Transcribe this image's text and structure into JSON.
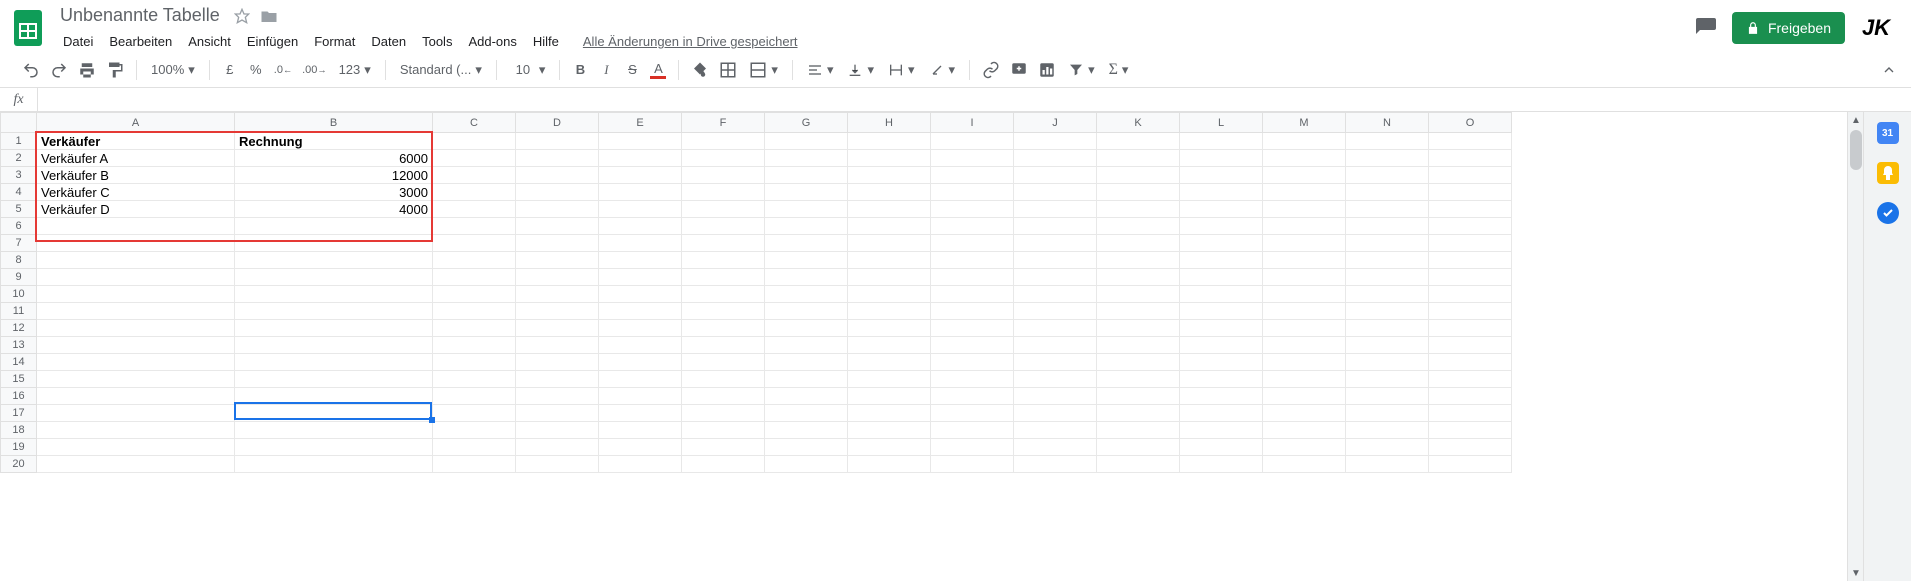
{
  "doc": {
    "title": "Unbenannte Tabelle"
  },
  "menu": {
    "file": "Datei",
    "edit": "Bearbeiten",
    "view": "Ansicht",
    "insert": "Einfügen",
    "format": "Format",
    "data": "Daten",
    "tools": "Tools",
    "addons": "Add-ons",
    "help": "Hilfe",
    "save_status": "Alle Änderungen in Drive gespeichert"
  },
  "share": {
    "label": "Freigeben"
  },
  "avatar": {
    "initials": "JK"
  },
  "toolbar": {
    "zoom": "100%",
    "currency": "£",
    "percent": "%",
    "dec_dec": ".0",
    "inc_dec": ".00",
    "numfmt": "123",
    "font": "Standard (...",
    "fontsize": "10"
  },
  "formula": {
    "fx": "fx",
    "value": ""
  },
  "columns": [
    "A",
    "B",
    "C",
    "D",
    "E",
    "F",
    "G",
    "H",
    "I",
    "J",
    "K",
    "L",
    "M",
    "N",
    "O"
  ],
  "row_count": 20,
  "sheet": {
    "headers": {
      "A": "Verkäufer",
      "B": "Rechnung"
    },
    "rows": [
      {
        "A": "Verkäufer A",
        "B": "6000"
      },
      {
        "A": "Verkäufer B",
        "B": "12000"
      },
      {
        "A": "Verkäufer C",
        "B": "3000"
      },
      {
        "A": "Verkäufer D",
        "B": "4000"
      }
    ]
  },
  "selection": {
    "cell": "B16"
  },
  "highlight": {
    "range": "A1:B6"
  },
  "sidepanel": {
    "calendar_day": "31"
  }
}
